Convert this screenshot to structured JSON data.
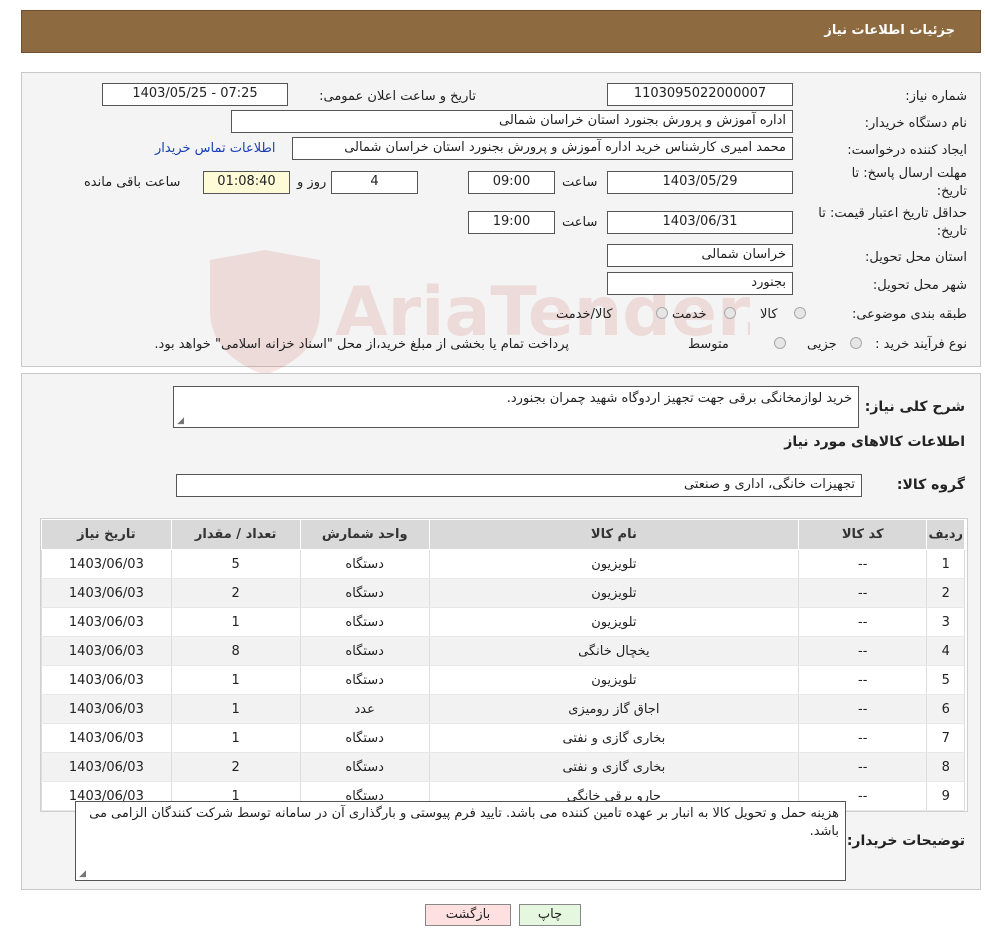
{
  "header": {
    "title": "جزئیات اطلاعات نیاز"
  },
  "watermark": {
    "text": "AriaTender.neT"
  },
  "form": {
    "need_number": {
      "label": "شماره نیاز:",
      "value": "1103095022000007"
    },
    "announce": {
      "label": "تاریخ و ساعت اعلان عمومی:",
      "value": "1403/05/25 - 07:25"
    },
    "buyer": {
      "label": "نام دستگاه خریدار:",
      "value": "اداره آموزش و پرورش بجنورد استان خراسان شمالی"
    },
    "creator": {
      "label": "ایجاد کننده درخواست:",
      "value": "محمد امیری کارشناس خرید اداره آموزش و پرورش بجنورد استان خراسان شمالی",
      "link": "اطلاعات تماس خریدار"
    },
    "deadline": {
      "label_line1": "مهلت ارسال پاسخ: تا",
      "label_line2": "تاریخ:",
      "date": "1403/05/29",
      "time_label": "ساعت",
      "time": "09:00",
      "days": "4",
      "days_label": "روز و",
      "remaining": "01:08:40",
      "remaining_label": "ساعت باقی مانده"
    },
    "validity": {
      "label_line1": "حداقل تاریخ اعتبار قیمت: تا",
      "label_line2": "تاریخ:",
      "date": "1403/06/31",
      "time_label": "ساعت",
      "time": "19:00"
    },
    "province": {
      "label": "استان محل تحویل:",
      "value": "خراسان شمالی"
    },
    "city": {
      "label": "شهر محل تحویل:",
      "value": "بجنورد"
    },
    "category": {
      "label": "طبقه بندی موضوعی:",
      "options": [
        "کالا",
        "خدمت",
        "کالا/خدمت"
      ]
    },
    "process": {
      "label": "نوع فرآیند خرید :",
      "options": [
        "جزیی",
        "متوسط"
      ],
      "note": "پرداخت تمام یا بخشی از مبلغ خرید،از محل \"اسناد خزانه اسلامی\" خواهد بود."
    }
  },
  "details": {
    "summary_label": "شرح کلی نیاز:",
    "summary": "خرید لوازمخانگی برقی جهت تجهیز اردوگاه شهید چمران بجنورد.",
    "goods_title": "اطلاعات کالاهای مورد نیاز",
    "group_label": "گروه کالا:",
    "group_value": "تجهیزات خانگی، اداری و صنعتی",
    "table": {
      "headers": [
        "ردیف",
        "کد کالا",
        "نام کالا",
        "واحد شمارش",
        "تعداد / مقدار",
        "تاریخ نیاز"
      ],
      "rows": [
        [
          "1",
          "--",
          "تلویزیون",
          "دستگاه",
          "5",
          "1403/06/03"
        ],
        [
          "2",
          "--",
          "تلویزیون",
          "دستگاه",
          "2",
          "1403/06/03"
        ],
        [
          "3",
          "--",
          "تلویزیون",
          "دستگاه",
          "1",
          "1403/06/03"
        ],
        [
          "4",
          "--",
          "یخچال خانگی",
          "دستگاه",
          "8",
          "1403/06/03"
        ],
        [
          "5",
          "--",
          "تلویزیون",
          "دستگاه",
          "1",
          "1403/06/03"
        ],
        [
          "6",
          "--",
          "اجاق گاز رومیزی",
          "عدد",
          "1",
          "1403/06/03"
        ],
        [
          "7",
          "--",
          "بخاری گازی و نفتی",
          "دستگاه",
          "1",
          "1403/06/03"
        ],
        [
          "8",
          "--",
          "بخاری گازی و نفتی",
          "دستگاه",
          "2",
          "1403/06/03"
        ],
        [
          "9",
          "--",
          "جارو برقی خانگی",
          "دستگاه",
          "1",
          "1403/06/03"
        ]
      ]
    },
    "buyer_notes_label": "توضیحات خریدار:",
    "buyer_notes": "هزینه حمل و تحویل کالا به انبار بر عهده تامین کننده می باشد. تایید فرم پیوستی و بارگذاری آن در سامانه توسط شرکت کنندگان الزامی می باشد."
  },
  "buttons": {
    "print": "چاپ",
    "back": "بازگشت"
  },
  "colors": {
    "header": "#8e6a40",
    "link": "#1a3db8",
    "remaining_bg": "#fffbd6",
    "back_bg": "#ffe0e0",
    "print_bg": "#e6f7e0"
  }
}
